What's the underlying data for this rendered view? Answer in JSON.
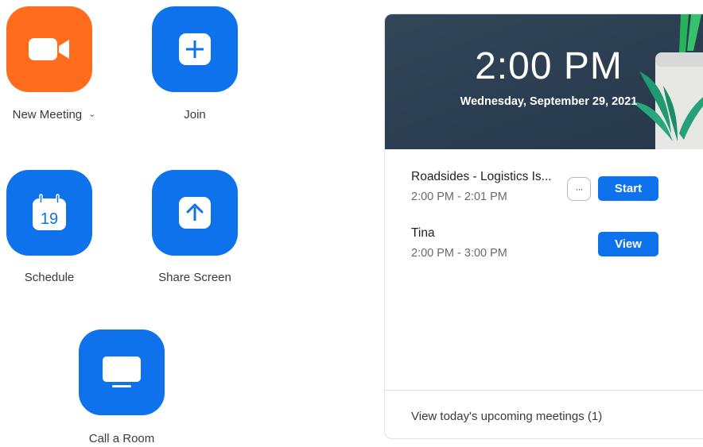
{
  "actions": {
    "new_meeting": {
      "label": "New Meeting",
      "color": "#ff6c1e",
      "icon": "video-camera-icon"
    },
    "join": {
      "label": "Join",
      "color": "#0e72ed",
      "icon": "plus-icon"
    },
    "schedule": {
      "label": "Schedule",
      "color": "#0e72ed",
      "icon": "calendar-icon",
      "calendar_day": "19"
    },
    "share_screen": {
      "label": "Share Screen",
      "color": "#0e72ed",
      "icon": "share-up-arrow-icon"
    },
    "call_room": {
      "label": "Call a Room",
      "color": "#0e72ed",
      "icon": "monitor-icon"
    }
  },
  "clock": {
    "time": "2:00 PM",
    "date": "Wednesday, September 29, 2021"
  },
  "meetings": [
    {
      "title": "Roadsides - Logistics Is...",
      "time": "2:00 PM - 2:01 PM",
      "more_label": "···",
      "action_label": "Start"
    },
    {
      "title": "Tina",
      "time": "2:00 PM - 3:00 PM",
      "action_label": "View"
    }
  ],
  "upcoming_link": "View today's upcoming meetings (1)",
  "colors": {
    "accent_blue": "#0e72ed",
    "accent_orange": "#ff6c1e",
    "hero_bg": "#2f4356"
  }
}
